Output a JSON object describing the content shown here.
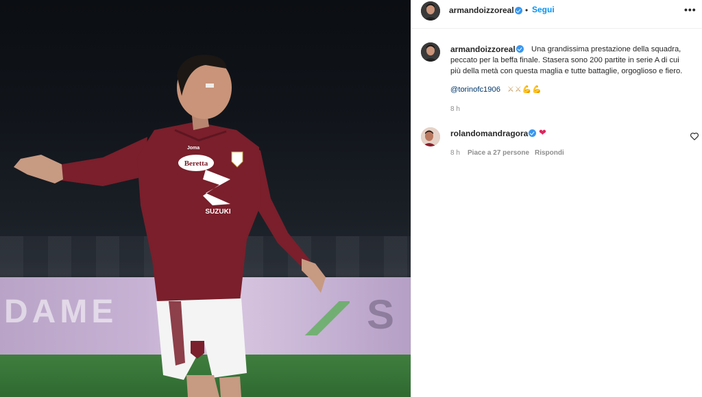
{
  "post": {
    "author": "armandoizzoreal",
    "follow_label": "Segui",
    "separator": "•",
    "more_label": "•••",
    "caption": "Una grandissima prestazione della squadra, peccato per la beffa finale. Stasera sono 200 partite in serie A di cui più della metà con questa maglia e tutte battaglie, orgoglioso e fiero.",
    "mention": "@torinofc1906",
    "emojis": "⚔⚔💪💪",
    "time": "8 h"
  },
  "photo": {
    "board_text": "DAME",
    "shirt_sponsor": "Beretta",
    "shirt_sponsor_2": "SUZUKI",
    "kit_brand": "Joma"
  },
  "comments": [
    {
      "username": "rolandomandragora",
      "text": "❤",
      "time": "8 h",
      "likes": "Piace a 27 persone",
      "reply_label": "Rispondi"
    }
  ],
  "colors": {
    "accent": "#0095f6",
    "verified": "#3897f0",
    "shirt": "#7a1f2b",
    "link": "#00376b"
  }
}
